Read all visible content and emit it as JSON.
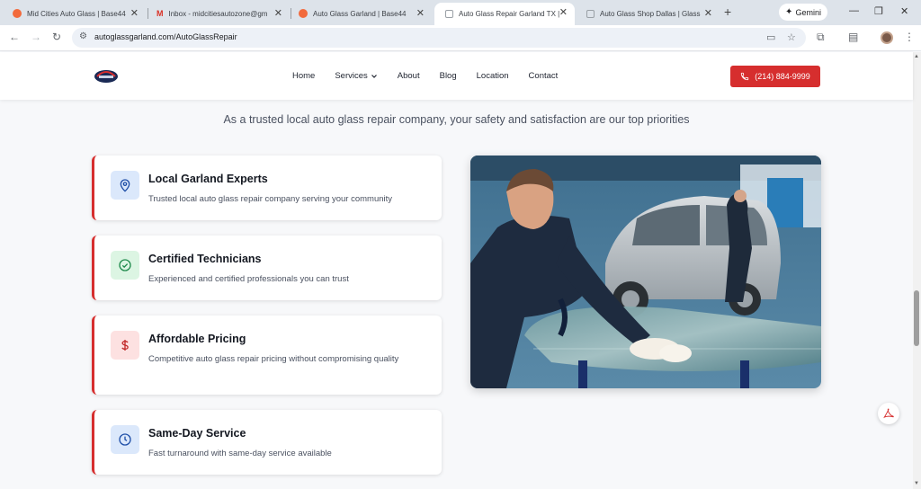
{
  "browser": {
    "tabs": [
      {
        "title": "Mid Cities Auto Glass | Base44",
        "favicon": "orange-dot"
      },
      {
        "title": "Inbox - midcitiesautozone@gm",
        "favicon": "gmail"
      },
      {
        "title": "Auto Glass Garland | Base44",
        "favicon": "orange-dot"
      },
      {
        "title": "Auto Glass Repair Garland TX |",
        "favicon": "page",
        "active": true
      },
      {
        "title": "Auto Glass Shop Dallas | Glass",
        "favicon": "page"
      }
    ],
    "new_tab": "+",
    "gemini_label": "Gemini",
    "url": "autoglassgarland.com/AutoGlassRepair"
  },
  "site": {
    "nav": {
      "home": "Home",
      "services": "Services",
      "about": "About",
      "blog": "Blog",
      "location": "Location",
      "contact": "Contact"
    },
    "phone": "(214) 884-9999",
    "brand_color": "#d62e2e"
  },
  "section": {
    "subheading": "As a trusted local auto glass repair company, your safety and satisfaction are our top priorities"
  },
  "features": [
    {
      "title": "Local Garland Experts",
      "desc": "Trusted local auto glass repair company serving your community",
      "icon": "map-pin-icon"
    },
    {
      "title": "Certified Technicians",
      "desc": "Experienced and certified professionals you can trust",
      "icon": "check-circle-icon"
    },
    {
      "title": "Affordable Pricing",
      "desc": "Competitive auto glass repair pricing without compromising quality",
      "icon": "dollar-icon"
    },
    {
      "title": "Same-Day Service",
      "desc": "Fast turnaround with same-day service available",
      "icon": "clock-icon"
    }
  ]
}
